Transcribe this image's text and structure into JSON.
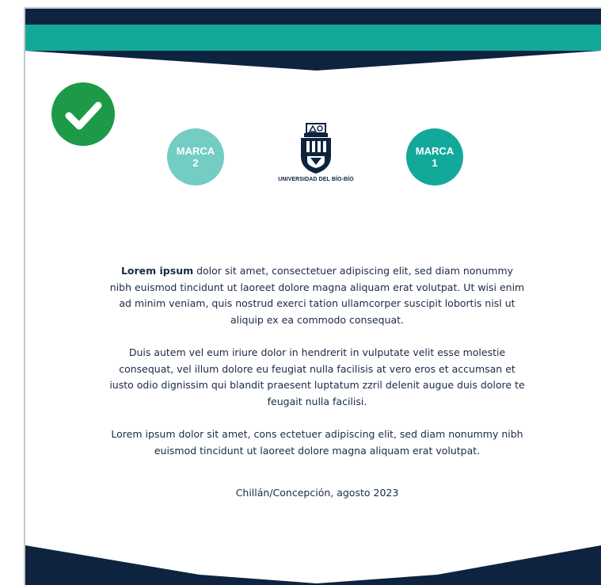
{
  "colors": {
    "navy": "#0d2340",
    "teal": "#13a99a",
    "teal_light": "#73cdc3",
    "check_green": "#1d9a47",
    "text": "#1a2b44"
  },
  "icons": {
    "badge": "checkmark-icon",
    "logo": "university-shield-icon"
  },
  "brands": {
    "marca2": {
      "word": "MARCA",
      "number": "2"
    },
    "marca1": {
      "word": "MARCA",
      "number": "1"
    }
  },
  "logo": {
    "name": "UNIVERSIDAD DEL BÍO-BÍO"
  },
  "body": {
    "p1_lead": "Lorem ipsum",
    "p1_rest": " dolor sit amet, consectetuer adipiscing elit, sed diam nonummy nibh euismod tincidunt ut laoreet dolore magna aliquam erat volutpat. Ut wisi enim ad minim veniam, quis nostrud exerci tation ullamcorper suscipit lobortis nisl ut aliquip ex ea commodo consequat.",
    "p2": "Duis autem vel eum iriure dolor in hendrerit in vulputate velit esse molestie consequat, vel illum dolore eu feugiat nulla facilisis at vero eros et accumsan et iusto odio dignissim qui blandit praesent luptatum zzril delenit augue duis dolore te feugait nulla facilisi.",
    "p3": "Lorem ipsum dolor sit amet, cons ectetuer adipiscing elit, sed diam nonummy nibh euismod tincidunt ut laoreet dolore magna aliquam erat volutpat.",
    "place_date": "Chillán/Concepción, agosto 2023"
  }
}
